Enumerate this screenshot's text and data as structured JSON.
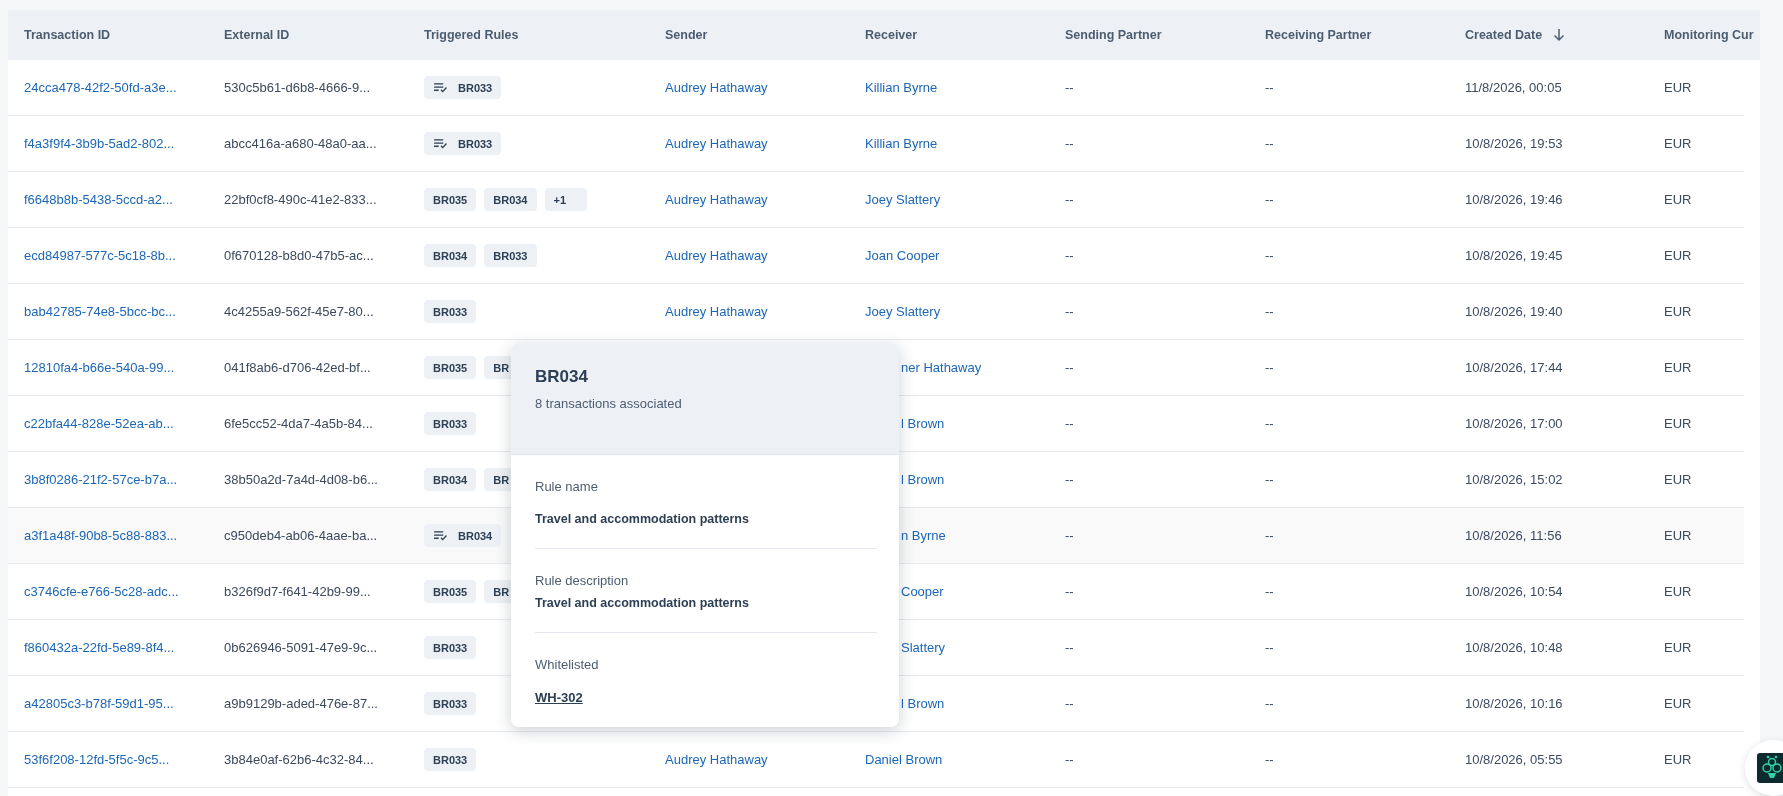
{
  "table": {
    "columns": [
      {
        "label": "Transaction ID"
      },
      {
        "label": "External ID"
      },
      {
        "label": "Triggered Rules"
      },
      {
        "label": "Sender"
      },
      {
        "label": "Receiver"
      },
      {
        "label": "Sending Partner"
      },
      {
        "label": "Receiving Partner"
      },
      {
        "label": "Created Date",
        "sorted": true
      },
      {
        "label": "Monitoring Cur"
      }
    ],
    "rows": [
      {
        "transaction_id": "24cca478-42f2-50fd-a3e...",
        "external_id": "530c5b61-d6b8-4666-9...",
        "rules": [
          {
            "label": "BR033",
            "whitelisted": true
          }
        ],
        "sender": "Audrey Hathaway",
        "receiver": "Killian Byrne",
        "sending_partner": "--",
        "receiving_partner": "--",
        "created": "11/8/2026, 00:05",
        "currency": "EUR",
        "hovered": false
      },
      {
        "transaction_id": "f4a3f9f4-3b9b-5ad2-802...",
        "external_id": "abcc416a-a680-48a0-aa...",
        "rules": [
          {
            "label": "BR033",
            "whitelisted": true
          }
        ],
        "sender": "Audrey Hathaway",
        "receiver": "Killian Byrne",
        "sending_partner": "--",
        "receiving_partner": "--",
        "created": "10/8/2026, 19:53",
        "currency": "EUR",
        "hovered": false
      },
      {
        "transaction_id": "f6648b8b-5438-5ccd-a2...",
        "external_id": "22bf0cf8-490c-41e2-833...",
        "rules": [
          {
            "label": "BR035",
            "whitelisted": false
          },
          {
            "label": "BR034",
            "whitelisted": false
          },
          {
            "label": "+1",
            "whitelisted": false
          }
        ],
        "sender": "Audrey Hathaway",
        "receiver": "Joey Slattery",
        "sending_partner": "--",
        "receiving_partner": "--",
        "created": "10/8/2026, 19:46",
        "currency": "EUR",
        "hovered": false
      },
      {
        "transaction_id": "ecd84987-577c-5c18-8b...",
        "external_id": "0f670128-b8d0-47b5-ac...",
        "rules": [
          {
            "label": "BR034",
            "whitelisted": false
          },
          {
            "label": "BR033",
            "whitelisted": false
          }
        ],
        "sender": "Audrey Hathaway",
        "receiver": "Joan Cooper",
        "sending_partner": "--",
        "receiving_partner": "--",
        "created": "10/8/2026, 19:45",
        "currency": "EUR",
        "hovered": false
      },
      {
        "transaction_id": "bab42785-74e8-5bcc-bc...",
        "external_id": "4c4255a9-562f-45e7-80...",
        "rules": [
          {
            "label": "BR033",
            "whitelisted": false
          }
        ],
        "sender": "Audrey Hathaway",
        "receiver": "Joey Slattery",
        "sending_partner": "--",
        "receiving_partner": "--",
        "created": "10/8/2026, 19:40",
        "currency": "EUR",
        "hovered": false
      },
      {
        "transaction_id": "12810fa4-b66e-540a-99...",
        "external_id": "041f8ab6-d706-42ed-bf...",
        "rules": [
          {
            "label": "BR035",
            "whitelisted": false
          },
          {
            "label": "BR",
            "whitelisted": false
          }
        ],
        "receiver_fragment": "ner Hathaway",
        "sending_partner": "--",
        "receiving_partner": "--",
        "created": "10/8/2026, 17:44",
        "currency": "EUR",
        "hovered": false
      },
      {
        "transaction_id": "c22bfa44-828e-52ea-ab...",
        "external_id": "6fe5cc52-4da7-4a5b-84...",
        "rules": [
          {
            "label": "BR033",
            "whitelisted": false
          }
        ],
        "receiver_fragment": "l Brown",
        "sending_partner": "--",
        "receiving_partner": "--",
        "created": "10/8/2026, 17:00",
        "currency": "EUR",
        "hovered": false
      },
      {
        "transaction_id": "3b8f0286-21f2-57ce-b7a...",
        "external_id": "38b50a2d-7a4d-4d08-b6...",
        "rules": [
          {
            "label": "BR034",
            "whitelisted": false
          },
          {
            "label": "BR",
            "whitelisted": false
          }
        ],
        "receiver_fragment": "l Brown",
        "sending_partner": "--",
        "receiving_partner": "--",
        "created": "10/8/2026, 15:02",
        "currency": "EUR",
        "hovered": false
      },
      {
        "transaction_id": "a3f1a48f-90b8-5c88-883...",
        "external_id": "c950deb4-ab06-4aae-ba...",
        "rules": [
          {
            "label": "BR034",
            "whitelisted": true
          }
        ],
        "receiver_fragment": "n Byrne",
        "sending_partner": "--",
        "receiving_partner": "--",
        "created": "10/8/2026, 11:56",
        "currency": "EUR",
        "hovered": true
      },
      {
        "transaction_id": "c3746cfe-e766-5c28-adc...",
        "external_id": "b326f9d7-f641-42b9-99...",
        "rules": [
          {
            "label": "BR035",
            "whitelisted": false
          },
          {
            "label": "BR",
            "whitelisted": false
          }
        ],
        "receiver_fragment": "Cooper",
        "sending_partner": "--",
        "receiving_partner": "--",
        "created": "10/8/2026, 10:54",
        "currency": "EUR",
        "hovered": false
      },
      {
        "transaction_id": "f860432a-22fd-5e89-8f4...",
        "external_id": "0b626946-5091-47e9-9c...",
        "rules": [
          {
            "label": "BR033",
            "whitelisted": false
          }
        ],
        "receiver_fragment": "Slattery",
        "sending_partner": "--",
        "receiving_partner": "--",
        "created": "10/8/2026, 10:48",
        "currency": "EUR",
        "hovered": false
      },
      {
        "transaction_id": "a42805c3-b78f-59d1-95...",
        "external_id": "a9b9129b-aded-476e-87...",
        "rules": [
          {
            "label": "BR033",
            "whitelisted": false
          }
        ],
        "receiver_fragment": "l Brown",
        "sending_partner": "--",
        "receiving_partner": "--",
        "created": "10/8/2026, 10:16",
        "currency": "EUR",
        "hovered": false
      },
      {
        "transaction_id": "53f6f208-12fd-5f5c-9c5...",
        "external_id": "3b84e0af-62b6-4c32-84...",
        "rules": [
          {
            "label": "BR033",
            "whitelisted": false
          }
        ],
        "sender": "Audrey Hathaway",
        "receiver": "Daniel Brown",
        "sending_partner": "--",
        "receiving_partner": "--",
        "created": "10/8/2026, 05:55",
        "currency": "EUR",
        "hovered": false
      }
    ]
  },
  "rule_popover": {
    "title": "BR034",
    "subtitle": "8 transactions associated",
    "fields": [
      {
        "label": "Rule name",
        "value": "Travel and accommodation patterns",
        "kind": "text"
      },
      {
        "label": "Rule description",
        "value": "Travel and accommodation patterns",
        "kind": "text"
      },
      {
        "label": "Whitelisted",
        "value": "WH-302",
        "kind": "link"
      }
    ]
  }
}
